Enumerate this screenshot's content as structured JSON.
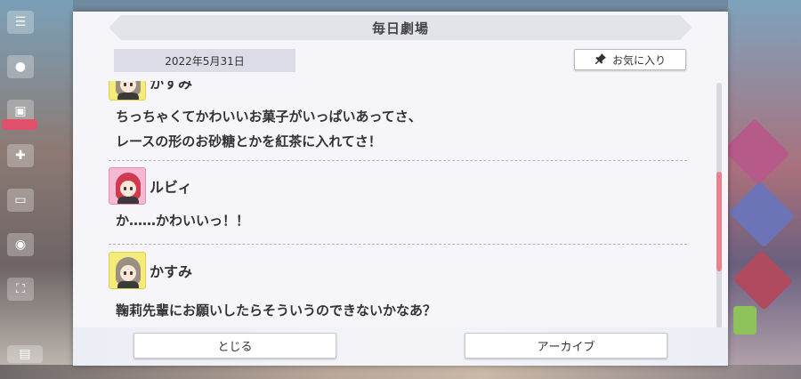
{
  "dialog": {
    "title": "毎日劇場",
    "date": "2022年5月31日",
    "favorite_label": "お気に入り",
    "close_label": "とじる",
    "archive_label": "アーカイブ"
  },
  "entries": [
    {
      "speaker": "かすみ",
      "lines": [
        "ちっちゃくてかわいいお菓子がいっぱいあってさ、",
        "レースの形のお砂糖とかを紅茶に入れてさ！"
      ]
    },
    {
      "speaker": "ルビィ",
      "lines": [
        "か……かわいいっ！！"
      ]
    },
    {
      "speaker": "かすみ",
      "lines": [
        "鞠莉先輩にお願いしたらそういうのできないかなあ？"
      ]
    }
  ],
  "icons": {
    "menu": "menu-icon",
    "favorite": "pin-icon"
  },
  "colors": {
    "scroll_thumb": "#ec7f8e",
    "kasumi_bg": "#f3ec7a",
    "ruby_bg": "#f5b9d3"
  }
}
